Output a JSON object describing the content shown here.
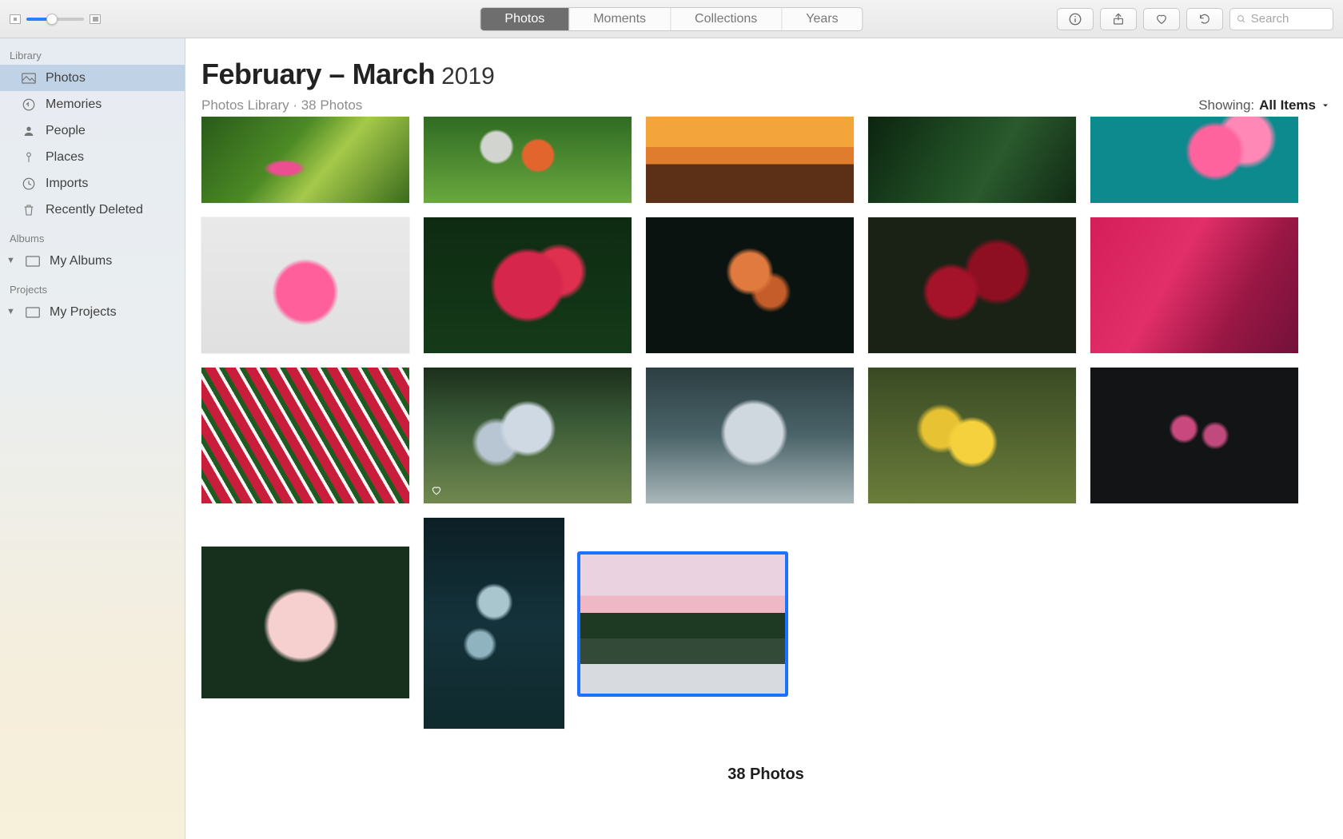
{
  "toolbar": {
    "tabs": [
      "Photos",
      "Moments",
      "Collections",
      "Years"
    ],
    "active_tab_index": 0,
    "search_placeholder": "Search"
  },
  "sidebar": {
    "sections": {
      "library_title": "Library",
      "library_items": [
        {
          "label": "Photos",
          "icon": "photos"
        },
        {
          "label": "Memories",
          "icon": "memories"
        },
        {
          "label": "People",
          "icon": "people"
        },
        {
          "label": "Places",
          "icon": "places"
        },
        {
          "label": "Imports",
          "icon": "imports"
        },
        {
          "label": "Recently Deleted",
          "icon": "trash"
        }
      ],
      "albums_title": "Albums",
      "albums_items": [
        {
          "label": "My Albums",
          "icon": "album"
        }
      ],
      "projects_title": "Projects",
      "projects_items": [
        {
          "label": "My Projects",
          "icon": "album"
        }
      ]
    }
  },
  "main": {
    "title_bold": "February – March",
    "title_year": "2019",
    "subtitle": "Photos Library · 38 Photos",
    "showing_label": "Showing:",
    "showing_value": "All Items",
    "footer_count": "38 Photos",
    "thumbnails": [
      {
        "favorite": false,
        "selected": false
      },
      {
        "favorite": false,
        "selected": false
      },
      {
        "favorite": false,
        "selected": false
      },
      {
        "favorite": false,
        "selected": false
      },
      {
        "favorite": false,
        "selected": false
      },
      {
        "favorite": false,
        "selected": false
      },
      {
        "favorite": false,
        "selected": false
      },
      {
        "favorite": false,
        "selected": false
      },
      {
        "favorite": false,
        "selected": false
      },
      {
        "favorite": false,
        "selected": false
      },
      {
        "favorite": false,
        "selected": false
      },
      {
        "favorite": true,
        "selected": false
      },
      {
        "favorite": false,
        "selected": false
      },
      {
        "favorite": false,
        "selected": false
      },
      {
        "favorite": false,
        "selected": false
      },
      {
        "favorite": false,
        "selected": false
      },
      {
        "favorite": false,
        "selected": false
      },
      {
        "favorite": false,
        "selected": true
      }
    ]
  }
}
